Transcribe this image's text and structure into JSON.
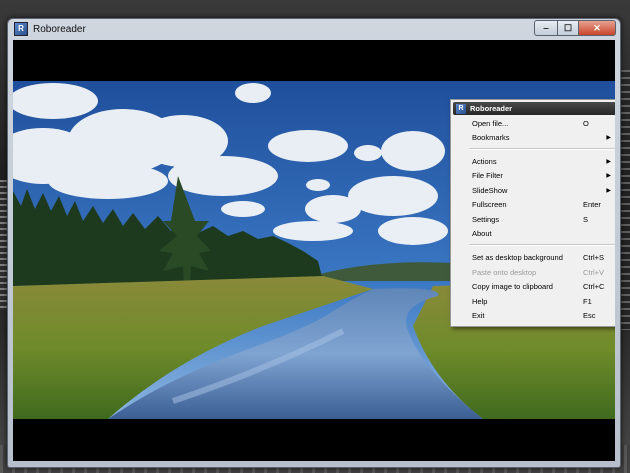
{
  "window": {
    "title": "Roboreader",
    "icon": "roboreader-app-icon",
    "controls": {
      "minimize_glyph": "‒",
      "maximize_glyph": "☐",
      "close_glyph": "✕"
    }
  },
  "image": {
    "description_icon": "landscape-photo"
  },
  "menu": {
    "header": "Roboreader",
    "items": [
      {
        "label": "Open file...",
        "shortcut": "O",
        "submenu": false,
        "disabled": false
      },
      {
        "label": "Bookmarks",
        "shortcut": "",
        "submenu": true,
        "disabled": false
      },
      {
        "label": "Actions",
        "shortcut": "",
        "submenu": true,
        "disabled": false
      },
      {
        "label": "File Filter",
        "shortcut": "",
        "submenu": true,
        "disabled": false
      },
      {
        "label": "SlideShow",
        "shortcut": "",
        "submenu": true,
        "disabled": false
      },
      {
        "label": "Fullscreen",
        "shortcut": "Enter",
        "submenu": false,
        "disabled": false
      },
      {
        "label": "Settings",
        "shortcut": "S",
        "submenu": false,
        "disabled": false
      },
      {
        "label": "About",
        "shortcut": "",
        "submenu": false,
        "disabled": false
      },
      {
        "label": "Set as desktop background",
        "shortcut": "Ctrl+S",
        "submenu": false,
        "disabled": false
      },
      {
        "label": "Paste onto desktop",
        "shortcut": "Ctrl+V",
        "submenu": false,
        "disabled": true
      },
      {
        "label": "Copy image to clipboard",
        "shortcut": "Ctrl+C",
        "submenu": false,
        "disabled": false
      },
      {
        "label": "Help",
        "shortcut": "F1",
        "submenu": false,
        "disabled": false
      },
      {
        "label": "Exit",
        "shortcut": "Esc",
        "submenu": false,
        "disabled": false
      }
    ],
    "submenu_arrow": "▶"
  },
  "colors": {
    "menu_header_bg": "#262626",
    "menu_bg": "#f0f0f0",
    "close_button": "#c8442c"
  }
}
